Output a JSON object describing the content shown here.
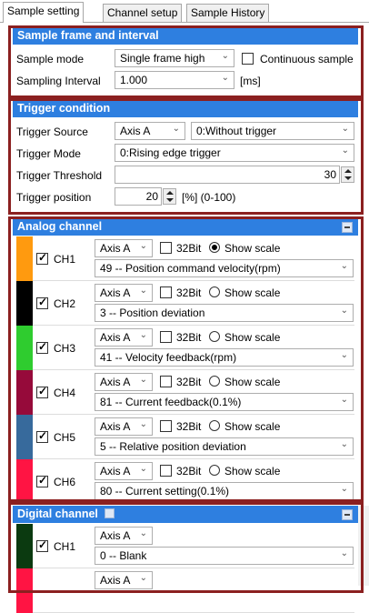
{
  "tabs": [
    "Sample setting",
    "Channel setup",
    "Sample History"
  ],
  "sample_frame": {
    "title": "Sample frame and interval",
    "mode_label": "Sample mode",
    "mode_value": "Single frame high",
    "continuous_label": "Continuous sample",
    "interval_label": "Sampling Interval",
    "interval_value": "1.000",
    "interval_unit": "[ms]"
  },
  "trigger": {
    "title": "Trigger condition",
    "source_label": "Trigger Source",
    "source_axis": "Axis A",
    "source_value": "0:Without trigger",
    "mode_label": "Trigger Mode",
    "mode_value": "0:Rising edge trigger",
    "threshold_label": "Trigger Threshold",
    "threshold_value": "30",
    "position_label": "Trigger position",
    "position_value": "20",
    "position_unit": "[%] (0-100)"
  },
  "analog": {
    "title": "Analog channel",
    "bit_label": "32Bit",
    "scale_label": "Show scale",
    "channels": [
      {
        "name": "CH1",
        "color": "#ff9a0f",
        "axis": "Axis A",
        "signal": "49 -- Position command velocity(rpm)",
        "checked": true,
        "show_scale": true
      },
      {
        "name": "CH2",
        "color": "#000000",
        "axis": "Axis A",
        "signal": "3 -- Position deviation",
        "checked": true,
        "show_scale": false
      },
      {
        "name": "CH3",
        "color": "#2fcc2f",
        "axis": "Axis A",
        "signal": "41 -- Velocity feedback(rpm)",
        "checked": true,
        "show_scale": false
      },
      {
        "name": "CH4",
        "color": "#960a3a",
        "axis": "Axis A",
        "signal": "81 -- Current feedback(0.1%)",
        "checked": true,
        "show_scale": false
      },
      {
        "name": "CH5",
        "color": "#376a9c",
        "axis": "Axis A",
        "signal": "5 -- Relative position deviation",
        "checked": true,
        "show_scale": false
      },
      {
        "name": "CH6",
        "color": "#ff1443",
        "axis": "Axis A",
        "signal": "80 -- Current setting(0.1%)",
        "checked": true,
        "show_scale": false
      }
    ]
  },
  "digital": {
    "title": "Digital channel",
    "channels": [
      {
        "name": "CH1",
        "color": "#0b3a10",
        "axis": "Axis A",
        "signal": "0 -- Blank",
        "checked": true
      },
      {
        "name": "",
        "color": "#ff1443",
        "axis": "Axis A",
        "signal": "",
        "checked": false
      }
    ]
  }
}
